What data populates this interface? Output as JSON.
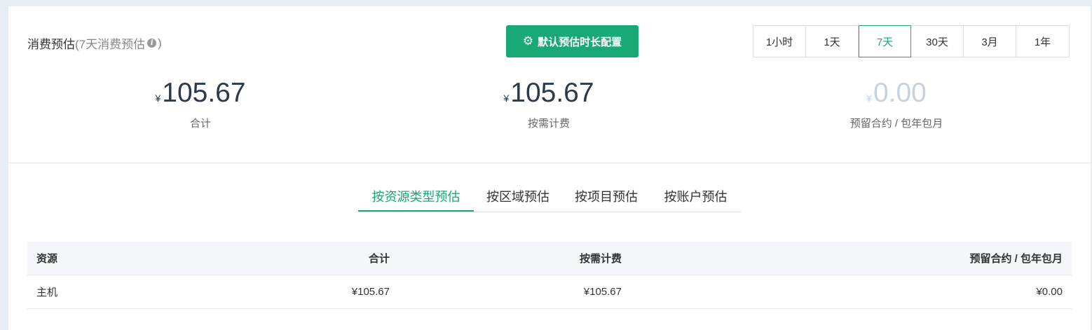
{
  "header": {
    "title": "消费预估",
    "subtitle_open": "(7天消费预估",
    "subtitle_close": ")",
    "config_button": "默认预估时长配置"
  },
  "ranges": [
    "1小时",
    "1天",
    "7天",
    "30天",
    "3月",
    "1年"
  ],
  "active_range": "7天",
  "stats": [
    {
      "currency": "¥",
      "value": "105.67",
      "label": "合计"
    },
    {
      "currency": "¥",
      "value": "105.67",
      "label": "按需计费"
    },
    {
      "currency": "¥",
      "value": "0.00",
      "label": "预留合约 / 包年包月"
    }
  ],
  "tabs": [
    "按资源类型预估",
    "按区域预估",
    "按项目预估",
    "按账户预估"
  ],
  "active_tab": "按资源类型预估",
  "table": {
    "columns": [
      "资源",
      "合计",
      "按需计费",
      "预留合约 / 包年包月"
    ],
    "rows": [
      [
        "主机",
        "¥105.67",
        "¥105.67",
        "¥0.00"
      ]
    ]
  },
  "colors": {
    "accent": "#19a974",
    "muted_value": "#c8d2de"
  }
}
